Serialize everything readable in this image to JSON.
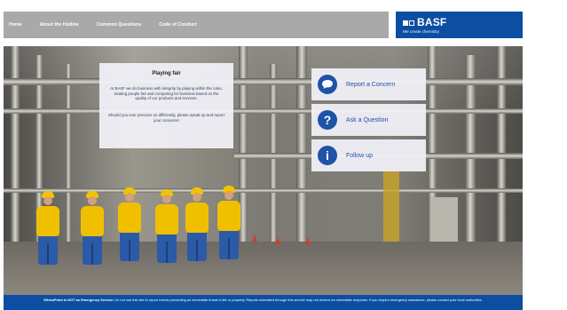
{
  "nav": {
    "items": [
      {
        "label": "Home"
      },
      {
        "label": "About the Hotline"
      },
      {
        "label": "Common Questions"
      },
      {
        "label": "Code of Conduct"
      }
    ]
  },
  "brand": {
    "name": "BASF",
    "tagline": "We create chemistry"
  },
  "info": {
    "title": "Playing fair",
    "p1": "At BASF we do business with integrity by playing within the rules, treating people fair and competing for business based on the quality of our products and services.",
    "p2": "Should you ever perceive us differently, please speak up and report your concerns!"
  },
  "actions": [
    {
      "label": "Report a Concern",
      "icon": "speech-bubble-icon"
    },
    {
      "label": "Ask a Question",
      "icon": "question-mark-icon"
    },
    {
      "label": "Follow up",
      "icon": "info-icon"
    }
  ],
  "footer": {
    "lead": "EthicsPoint is NOT an Emergency Service:",
    "text": "Do not use this site to report events presenting an immediate threat to life or property. Reports submitted through this service may not receive an immediate response. If you require emergency assistance, please contact your local authorities."
  },
  "colors": {
    "brand_blue": "#0b4ea2",
    "nav_gray": "#a9a9a9",
    "panel_bg": "#f0f0f6",
    "accent_blue": "#1e53a6"
  }
}
